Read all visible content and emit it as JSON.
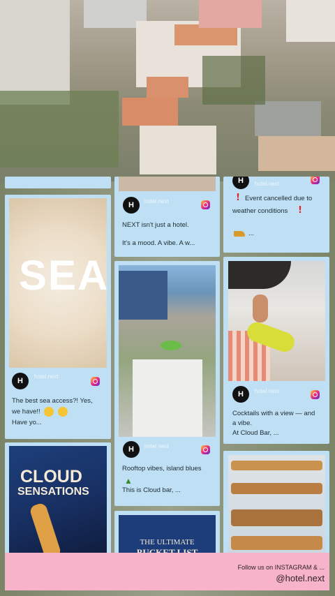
{
  "brand": {
    "handle": "hotel.next",
    "avatar_letter": "H"
  },
  "posts": {
    "p1": {
      "text_line1": "NEXT isn't just a hotel.",
      "text_line2": "It's a mood. A vibe. A w..."
    },
    "p2": {
      "text_line1": "Event cancelled due to",
      "text_line2": "weather conditions",
      "text_line3": "..."
    },
    "p3": {
      "image_text": "SEA",
      "text_line1": "The best sea access?! Yes,",
      "text_line2": "we have!!",
      "text_line3": "Have yo..."
    },
    "p4": {
      "text_line1": "Rooftop vibes, island blues",
      "text_line2": "This is Cloud bar, ..."
    },
    "p5": {
      "text_line1": "Cocktails with a view — and",
      "text_line2": "a vibe.",
      "text_line3": "At Cloud Bar, ..."
    },
    "p6": {
      "image_line1": "CLOUD",
      "image_line2": "SENSATIONS"
    },
    "p7": {
      "image_line1": "THE ULTIMATE",
      "image_line2": "BUCKET LIST"
    }
  },
  "footer": {
    "line1": "Follow us on INSTAGRAM & ...",
    "line2": "@hotel.next"
  },
  "colors": {
    "card": "#bfe0f4",
    "footer": "#f7b3ca",
    "avatar": "#111111"
  }
}
